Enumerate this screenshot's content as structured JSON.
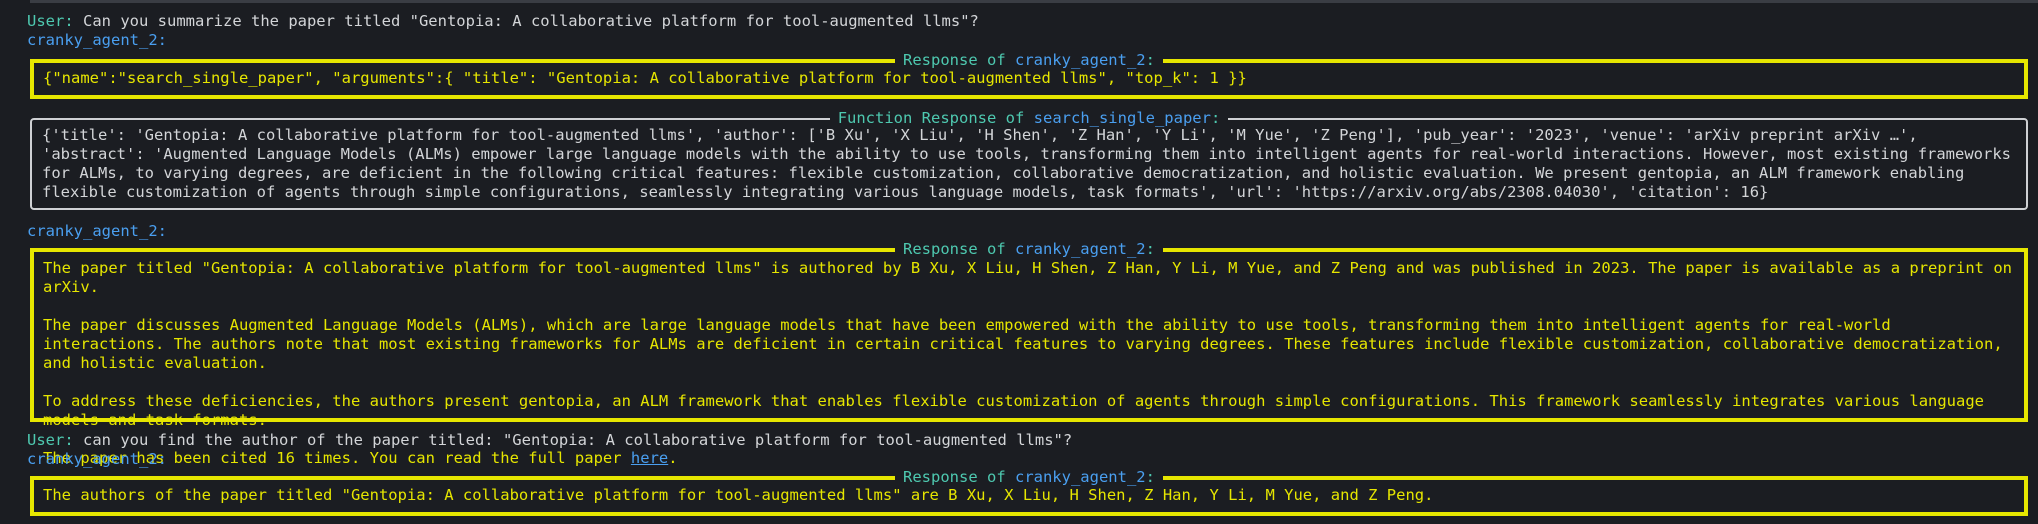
{
  "user_prefix": "User:",
  "agent_name": "cranky_agent_2",
  "agent_suffix": ":",
  "response_title_prefix": "Response of ",
  "response_title_suffix": ":",
  "exchange1": {
    "user_text": "Can you summarize the paper titled \"Gentopia: A collaborative platform for tool-augmented llms\"?",
    "call_text": "{\"name\":\"search_single_paper\", \"arguments\":{ \"title\": \"Gentopia: A collaborative platform for tool-augmented llms\", \"top_k\": 1 }}",
    "function_title_prefix": "Function Response of ",
    "function_name": "search_single_paper",
    "function_title_suffix": ":",
    "function_text": "{'title': 'Gentopia: A collaborative platform for tool-augmented llms', 'author': ['B Xu', 'X Liu', 'H Shen', 'Z Han', 'Y Li', 'M Yue', 'Z Peng'], 'pub_year': '2023', 'venue': 'arXiv preprint arXiv …', 'abstract': 'Augmented Language Models (ALMs) empower large language models with the ability to use tools, transforming them into intelligent agents for real-world interactions. However, most existing frameworks for ALMs, to varying degrees, are deficient in the following critical features: flexible customization, collaborative democratization, and holistic evaluation. We present gentopia, an ALM framework enabling flexible customization of agents through simple configurations, seamlessly integrating various language models, task formats', 'url': 'https://arxiv.org/abs/2308.04030', 'citation': 16}",
    "answer_p1": "The paper titled \"Gentopia: A collaborative platform for tool-augmented llms\" is authored by B Xu, X Liu, H Shen, Z Han, Y Li, M Yue, and Z Peng and was published in 2023. The paper is available as a preprint on arXiv.",
    "answer_p2": "The paper discusses Augmented Language Models (ALMs), which are large language models that have been empowered with the ability to use tools, transforming them into intelligent agents for real-world interactions. The authors note that most existing frameworks for ALMs are deficient in certain critical features to varying degrees. These features include flexible customization, collaborative democratization, and holistic evaluation.",
    "answer_p3": "To address these deficiencies, the authors present gentopia, an ALM framework that enables flexible customization of agents through simple configurations. This framework seamlessly integrates various language models and task formats.",
    "answer_p4_before": "The paper has been cited 16 times. You can read the full paper ",
    "answer_p4_link": "here",
    "answer_p4_after": "."
  },
  "exchange2": {
    "user_text": "can you find the author of the paper titled: \"Gentopia: A collaborative platform for tool-augmented llms\"?",
    "answer_text": "The authors of the paper titled \"Gentopia: A collaborative platform for tool-augmented llms\" are B Xu, X Liu, H Shen, Z Han, Y Li, M Yue, and Z Peng."
  }
}
